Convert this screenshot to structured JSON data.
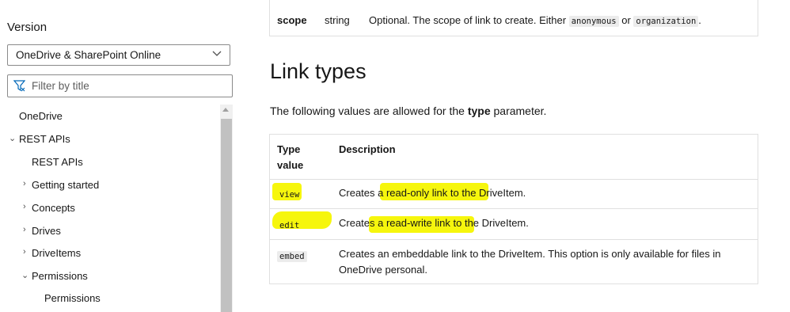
{
  "sidebar": {
    "version_label": "Version",
    "version_selected": "OneDrive & SharePoint Online",
    "filter_placeholder": "Filter by title",
    "nav": {
      "onedrive": "OneDrive",
      "rest_apis": "REST APIs",
      "rest_apis_child": "REST APIs",
      "getting_started": "Getting started",
      "concepts": "Concepts",
      "drives": "Drives",
      "driveitems": "DriveItems",
      "permissions": "Permissions",
      "permissions_child": "Permissions"
    }
  },
  "params_table": {
    "name": "scope",
    "type": "string",
    "desc_prefix": "Optional. The scope of link to create. Either",
    "opt1": "anonymous",
    "or": "or",
    "opt2": "organization",
    "desc_suffix": "."
  },
  "link_types": {
    "heading": "Link types",
    "intro_prefix": "The following values are allowed for the",
    "intro_bold": "type",
    "intro_suffix": "parameter.",
    "header_type_line1": "Type",
    "header_type_line2": "value",
    "header_desc": "Description",
    "rows": [
      {
        "value": "view",
        "desc": "Creates a read-only link to the DriveItem."
      },
      {
        "value": "edit",
        "desc": "Creates a read-write link to the DriveItem."
      },
      {
        "value": "embed",
        "desc_line1": "Creates an embeddable link to the DriveItem. This option is only available for files in",
        "desc_line2": "OneDrive personal."
      }
    ]
  },
  "colors": {
    "highlight": "#f5f500",
    "border": "#e0e0e0",
    "code_bg": "#ececec"
  }
}
